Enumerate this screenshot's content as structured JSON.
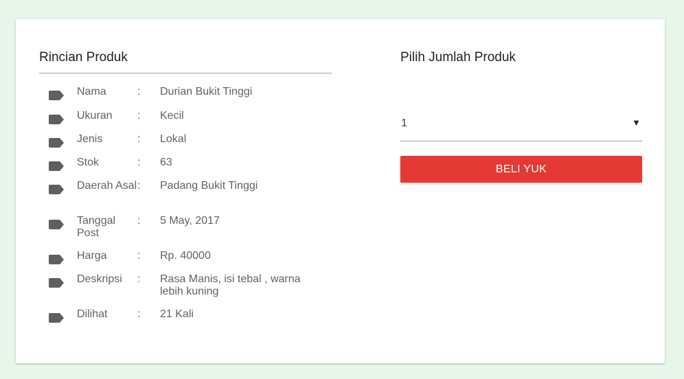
{
  "details": {
    "title": "Rincian Produk",
    "colon": ":",
    "icon": "tag-icon",
    "rows": [
      {
        "label": "Nama",
        "value": "Durian Bukit Tinggi"
      },
      {
        "label": "Ukuran",
        "value": "Kecil"
      },
      {
        "label": "Jenis",
        "value": "Lokal"
      },
      {
        "label": "Stok",
        "value": "63"
      },
      {
        "label": "Daerah Asal",
        "value": "Padang Bukit Tinggi"
      },
      {
        "label": "Tanggal Post",
        "value": "5 May, 2017"
      },
      {
        "label": "Harga",
        "value": "Rp. 40000"
      },
      {
        "label": "Deskripsi",
        "value": "Rasa Manis, isi tebal , warna lebih kuning"
      },
      {
        "label": "Dilihat",
        "value": "21 Kali"
      }
    ]
  },
  "quantity": {
    "title": "Pilih Jumlah Produk",
    "selected": "1",
    "dropdown_glyph": "▼",
    "button_label": "BELI YUK",
    "button_color": "#e53935"
  }
}
